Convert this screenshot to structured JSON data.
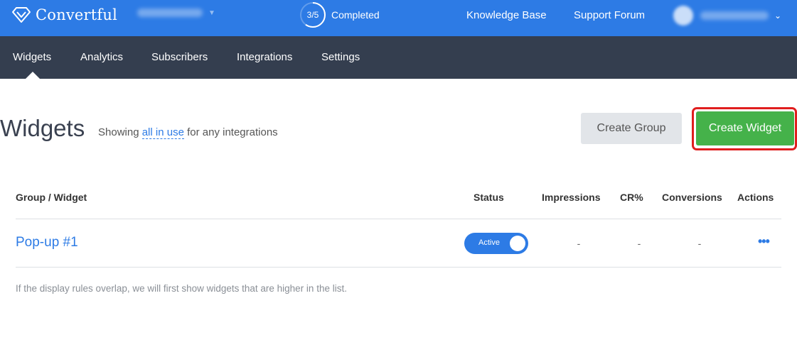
{
  "topbar": {
    "brand": "Convertful",
    "progress": {
      "value": 0.6,
      "text": "3/5",
      "label": "Completed"
    },
    "links": [
      {
        "label": "Knowledge Base"
      },
      {
        "label": "Support Forum"
      }
    ],
    "colors": {
      "background": "#2d7be5"
    }
  },
  "nav": {
    "items": [
      {
        "label": "Widgets",
        "active": true
      },
      {
        "label": "Analytics"
      },
      {
        "label": "Subscribers"
      },
      {
        "label": "Integrations"
      },
      {
        "label": "Settings"
      }
    ],
    "colors": {
      "background": "#343e4f"
    }
  },
  "page": {
    "title": "Widgets",
    "showing_prefix": "Showing ",
    "filter_link": "all in use",
    "showing_suffix": " for any integrations",
    "buttons": {
      "create_group": "Create Group",
      "create_widget": "Create Widget"
    },
    "colors": {
      "create_widget": "#45b24a",
      "highlight": "#e01e1e"
    }
  },
  "table": {
    "headers": [
      "Group / Widget",
      "Status",
      "Impressions",
      "CR%",
      "Conversions",
      "Actions"
    ],
    "rows": [
      {
        "name": "Pop-up #1",
        "status": "Active",
        "impressions": "-",
        "cr": "-",
        "conversions": "-",
        "actions": "•••"
      }
    ],
    "footnote": "If the display rules overlap, we will first show widgets that are higher in the list."
  }
}
